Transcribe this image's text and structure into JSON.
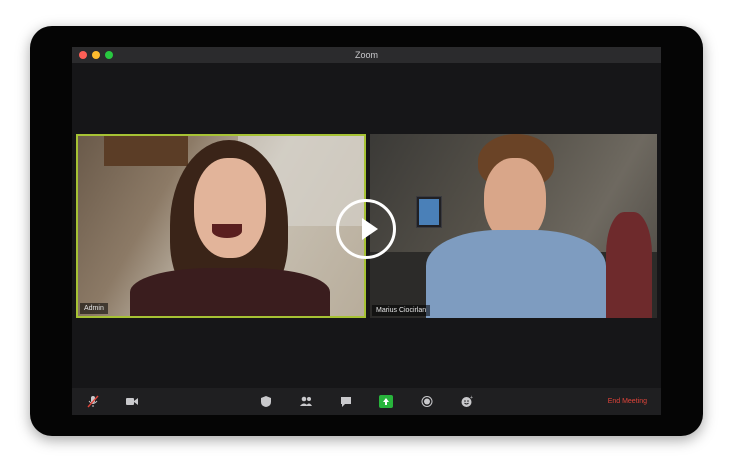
{
  "window": {
    "title": "Zoom"
  },
  "participants": [
    {
      "name": "Admin",
      "active_speaker": true
    },
    {
      "name": "Marius Ciocirlan",
      "active_speaker": false
    }
  ],
  "toolbar": {
    "items": [
      {
        "icon": "microphone-muted-icon"
      },
      {
        "icon": "video-camera-icon"
      },
      {
        "icon": "security-shield-icon"
      },
      {
        "icon": "participants-icon"
      },
      {
        "icon": "chat-icon"
      },
      {
        "icon": "share-screen-icon"
      },
      {
        "icon": "record-icon"
      },
      {
        "icon": "reactions-icon"
      }
    ],
    "end_meeting_label": "End Meeting"
  },
  "overlay": {
    "icon": "play-icon"
  },
  "colors": {
    "active_speaker_border": "#a6c234",
    "share_button": "#28b43c",
    "end_meeting": "#e0443a"
  }
}
